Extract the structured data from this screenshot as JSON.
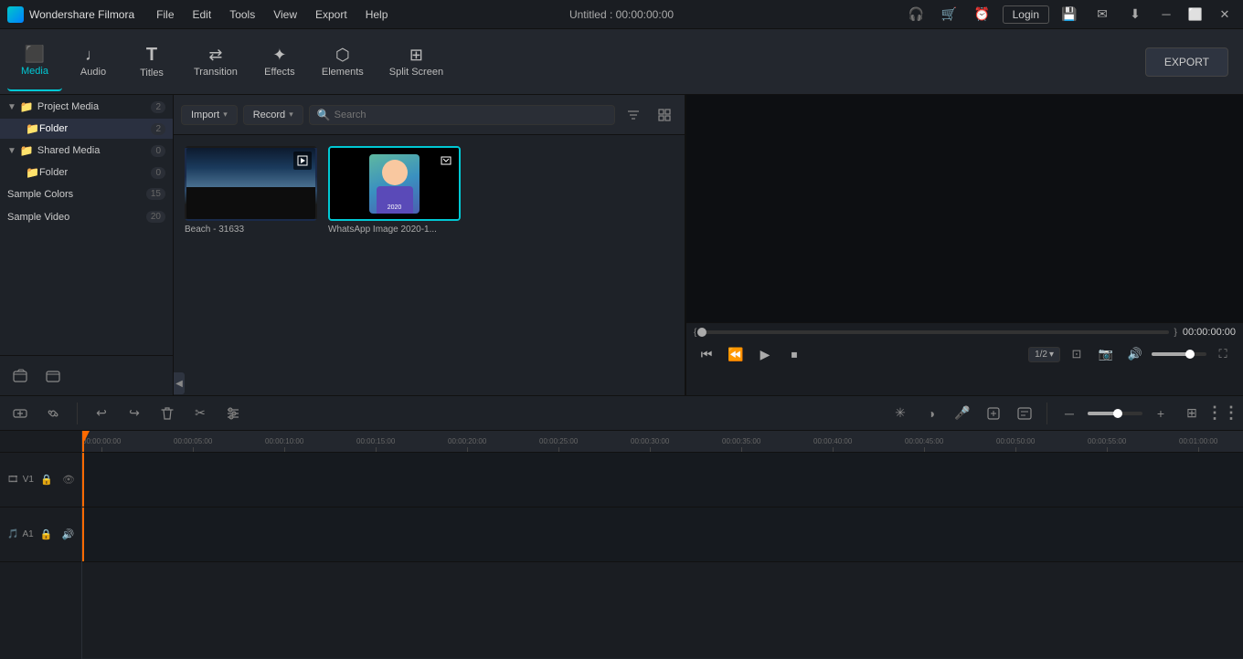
{
  "app": {
    "name": "Wondershare Filmora",
    "title": "Untitled : 00:00:00:00"
  },
  "menu": {
    "items": [
      "File",
      "Edit",
      "Tools",
      "View",
      "Export",
      "Help"
    ]
  },
  "toolbar": {
    "buttons": [
      {
        "id": "media",
        "label": "Media",
        "icon": "🎞",
        "active": true
      },
      {
        "id": "audio",
        "label": "Audio",
        "icon": "🎵",
        "active": false
      },
      {
        "id": "titles",
        "label": "Titles",
        "icon": "T",
        "active": false
      },
      {
        "id": "transition",
        "label": "Transition",
        "icon": "⇄",
        "active": false
      },
      {
        "id": "effects",
        "label": "Effects",
        "icon": "✦",
        "active": false
      },
      {
        "id": "elements",
        "label": "Elements",
        "icon": "⬡",
        "active": false
      },
      {
        "id": "splitscreen",
        "label": "Split Screen",
        "icon": "⊞",
        "active": false
      }
    ],
    "export_label": "EXPORT"
  },
  "left_panel": {
    "sections": [
      {
        "id": "project-media",
        "label": "Project Media",
        "count": 2,
        "expanded": true,
        "children": [
          {
            "id": "folder",
            "label": "Folder",
            "count": 2,
            "active": true
          }
        ]
      },
      {
        "id": "shared-media",
        "label": "Shared Media",
        "count": 0,
        "expanded": true,
        "children": [
          {
            "id": "folder2",
            "label": "Folder",
            "count": 0,
            "active": false
          }
        ]
      },
      {
        "id": "sample-colors",
        "label": "Sample Colors",
        "count": 15,
        "expanded": false,
        "children": []
      },
      {
        "id": "sample-video",
        "label": "Sample Video",
        "count": 20,
        "expanded": false,
        "children": []
      }
    ]
  },
  "media_toolbar": {
    "import_label": "Import",
    "record_label": "Record",
    "search_placeholder": "Search",
    "filter_icon": "filter-icon",
    "grid_icon": "grid-icon"
  },
  "media_items": [
    {
      "id": "beach",
      "label": "Beach - 31633",
      "type": "video",
      "thumb_type": "beach"
    },
    {
      "id": "whatsapp",
      "label": "WhatsApp Image 2020-1...",
      "type": "image",
      "thumb_type": "avatar",
      "selected": true
    }
  ],
  "preview": {
    "timestamp": "00:00:00:00",
    "quality": "1/2",
    "progress": 0
  },
  "timeline": {
    "toolbar_buttons": [
      {
        "id": "undo",
        "icon": "↩",
        "label": "undo"
      },
      {
        "id": "redo",
        "icon": "↪",
        "label": "redo"
      },
      {
        "id": "delete",
        "icon": "🗑",
        "label": "delete"
      },
      {
        "id": "cut",
        "icon": "✂",
        "label": "cut"
      },
      {
        "id": "adjust",
        "icon": "≡",
        "label": "adjust"
      }
    ],
    "right_buttons": [
      {
        "id": "motion",
        "icon": "✳",
        "label": "motion"
      },
      {
        "id": "color",
        "icon": "◑",
        "label": "color"
      },
      {
        "id": "audio-tools",
        "icon": "🎤",
        "label": "audio"
      },
      {
        "id": "auto",
        "icon": "⊡",
        "label": "auto"
      },
      {
        "id": "captions",
        "icon": "⊟",
        "label": "captions"
      },
      {
        "id": "zoom-in",
        "icon": "⊙",
        "label": "zoom"
      },
      {
        "id": "zoom-out",
        "icon": "⊕",
        "label": "zoom-out"
      },
      {
        "id": "zoom-fit",
        "icon": "⊞",
        "label": "fit"
      }
    ],
    "ruler_marks": [
      "00:00:00:00",
      "00:00:05:00",
      "00:00:10:00",
      "00:00:15:00",
      "00:00:20:00",
      "00:00:25:00",
      "00:00:30:00",
      "00:00:35:00",
      "00:00:40:00",
      "00:00:45:00",
      "00:00:50:00",
      "00:00:55:00",
      "00:01:00:00"
    ],
    "tracks": [
      {
        "id": "video-track-1",
        "icon": "🎞",
        "label": "V1",
        "lock": false,
        "visible": true
      },
      {
        "id": "audio-track-1",
        "icon": "🎵",
        "label": "A1",
        "lock": false,
        "mute": false
      }
    ]
  }
}
